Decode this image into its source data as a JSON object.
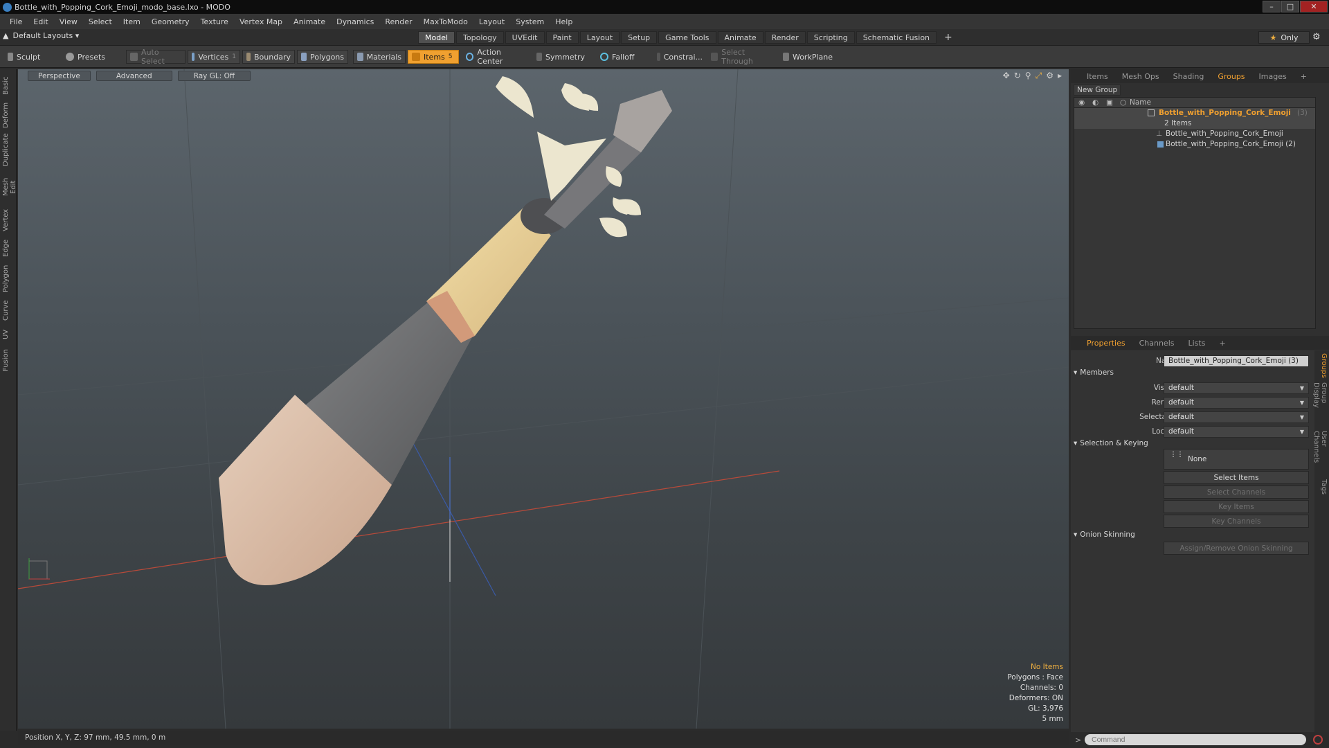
{
  "window": {
    "title": "Bottle_with_Popping_Cork_Emoji_modo_base.lxo - MODO"
  },
  "menu": [
    "File",
    "Edit",
    "View",
    "Select",
    "Item",
    "Geometry",
    "Texture",
    "Vertex Map",
    "Animate",
    "Dynamics",
    "Render",
    "MaxToModo",
    "Layout",
    "System",
    "Help"
  ],
  "layout_selector": "Default Layouts",
  "mode_tabs": [
    "Model",
    "Topology",
    "UVEdit",
    "Paint",
    "Layout",
    "Setup",
    "Game Tools",
    "Animate",
    "Render",
    "Scripting",
    "Schematic Fusion"
  ],
  "only_label": "Only",
  "toolbar": {
    "sculpt": "Sculpt",
    "presets": "Presets",
    "auto_select": "Auto Select",
    "vertices": "Vertices",
    "vertices_count": "1",
    "boundary": "Boundary",
    "polygons": "Polygons",
    "materials": "Materials",
    "items": "Items",
    "items_count": "5",
    "action_center": "Action Center",
    "symmetry": "Symmetry",
    "falloff": "Falloff",
    "constrain": "Constrai...",
    "select_through": "Select Through",
    "workplane": "WorkPlane"
  },
  "left_tabs": [
    "Basic",
    "Deform",
    "Duplicate",
    "Mesh Edit",
    "Vertex",
    "Edge",
    "Polygon",
    "Curve",
    "UV",
    "Fusion"
  ],
  "viewport": {
    "view": "Perspective",
    "advanced": "Advanced",
    "raygl": "Ray GL: Off",
    "info": {
      "noitems": "No Items",
      "polygons": "Polygons : Face",
      "channels": "Channels: 0",
      "deformers": "Deformers: ON",
      "gl": "GL: 3,976",
      "scale": "5 mm"
    }
  },
  "status": "Position X, Y, Z:  97 mm, 49.5 mm, 0 m",
  "panel_tabs": [
    "Items",
    "Mesh Ops",
    "Shading",
    "Groups",
    "Images"
  ],
  "new_group": "New Group",
  "tree": {
    "name_col": "Name",
    "group_name": "Bottle_with_Popping_Cork_Emoji",
    "group_count": "(3)",
    "item_count": "2 Items",
    "children": [
      "Bottle_with_Popping_Cork_Emoji",
      "Bottle_with_Popping_Cork_Emoji (2)"
    ]
  },
  "prop_tabs": [
    "Properties",
    "Channels",
    "Lists"
  ],
  "properties": {
    "name_label": "Name",
    "name_value": "Bottle_with_Popping_Cork_Emoji (3)",
    "members": "Members",
    "visible_label": "Visible",
    "visible": "default",
    "render_label": "Render",
    "render": "default",
    "selectable_label": "Selectable",
    "selectable": "default",
    "locked_label": "Locked",
    "locked": "default",
    "sel_keying": "Selection & Keying",
    "none": "None",
    "select_items": "Select Items",
    "select_channels": "Select Channels",
    "key_items": "Key Items",
    "key_channels": "Key Channels",
    "onion": "Onion Skinning",
    "assign_onion": "Assign/Remove Onion Skinning"
  },
  "right_vtabs": [
    "Groups",
    "Group Display",
    "User Channels",
    "Tags"
  ],
  "command_placeholder": "Command",
  "colors": {
    "accent": "#f0a030",
    "viewport_top": "#5c656c",
    "viewport_bottom": "#35393c"
  }
}
